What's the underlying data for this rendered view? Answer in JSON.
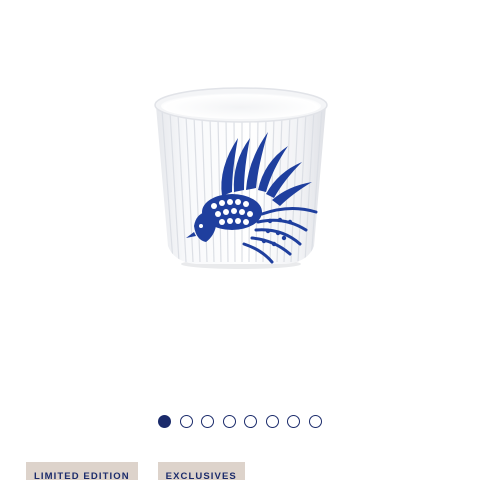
{
  "product": {
    "image_alt": "White ribbed porcelain cup with blue phoenix bird decoration"
  },
  "carousel": {
    "total": 8,
    "active_index": 0
  },
  "tags": [
    {
      "label": "LIMITED EDITION"
    },
    {
      "label": "EXCLUSIVES"
    }
  ],
  "colors": {
    "accent": "#1b2b6b",
    "tag_background": "#ddd3cb",
    "decoration_blue": "#1f3f9e"
  }
}
